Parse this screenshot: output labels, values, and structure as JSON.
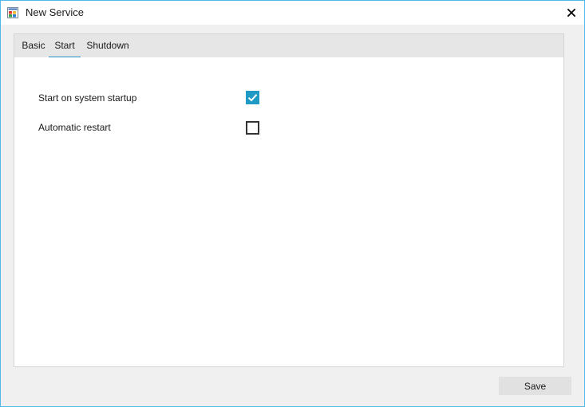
{
  "window": {
    "title": "New Service",
    "app_icon": "windows-app-icon",
    "close_icon": "close-icon",
    "border_color": "#52b8e8"
  },
  "tabs": [
    {
      "label": "Basic",
      "active": false
    },
    {
      "label": "Start",
      "active": true
    },
    {
      "label": "Shutdown",
      "active": false
    }
  ],
  "start_tab": {
    "options": [
      {
        "label": "Start on system startup",
        "checked": true
      },
      {
        "label": "Automatic restart",
        "checked": false
      }
    ]
  },
  "footer": {
    "save_label": "Save"
  },
  "colors": {
    "accent": "#1f9ac4",
    "tab_underline": "#1f8ec2"
  }
}
